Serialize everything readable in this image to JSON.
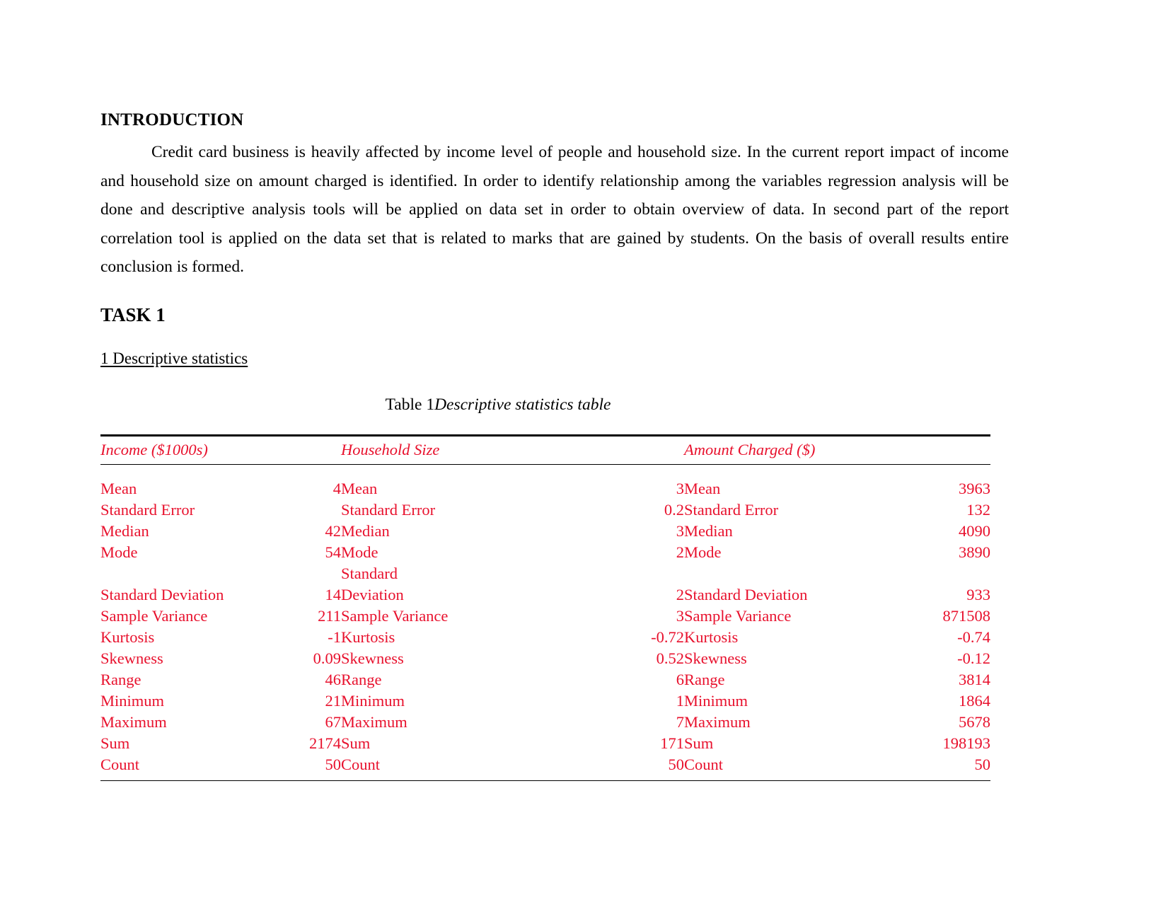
{
  "document": {
    "intro_heading": "INTRODUCTION",
    "intro_paragraph": "Credit card business is heavily affected by income level of people and household size. In the current report impact of income and household size on amount charged is identified. In order to identify relationship among the variables regression analysis will be done and descriptive analysis tools will be applied on data set in order to obtain overview of data. In second part of the report correlation tool is applied on the data set that is related to marks that are gained by students. On the basis of overall results entire conclusion is formed.",
    "task_heading": "TASK 1",
    "section_heading": "1 Descriptive statistics"
  },
  "table": {
    "caption_label": "Table 1",
    "caption_title": "Descriptive statistics table",
    "text_color": "#e8112d",
    "headers": [
      "Income ($1000s)",
      "Household Size",
      "Amount Charged ($)"
    ],
    "rows": [
      {
        "income_label": "Mean",
        "income_value": "4",
        "household_label": "Mean",
        "household_value": "3",
        "amount_label": "Mean",
        "amount_value": "3963"
      },
      {
        "income_label": "Standard Error",
        "income_value": "",
        "household_label": "Standard Error",
        "household_value": "0.2",
        "amount_label": "Standard Error",
        "amount_value": "132"
      },
      {
        "income_label": "Median",
        "income_value": "42",
        "household_label": "Median",
        "household_value": "3",
        "amount_label": "Median",
        "amount_value": "4090"
      },
      {
        "income_label": "Mode",
        "income_value": "54",
        "household_label": "Mode",
        "household_value": "2",
        "amount_label": "Mode",
        "amount_value": "3890"
      },
      {
        "income_label": "Standard Deviation",
        "income_value": "14",
        "household_label": "Standard Deviation",
        "household_value": "2",
        "amount_label": "Standard Deviation",
        "amount_value": "933"
      },
      {
        "income_label": "Sample Variance",
        "income_value": "211",
        "household_label": "Sample Variance",
        "household_value": "3",
        "amount_label": "Sample Variance",
        "amount_value": "871508"
      },
      {
        "income_label": "Kurtosis",
        "income_value": "-1",
        "household_label": "Kurtosis",
        "household_value": "-0.72",
        "amount_label": "Kurtosis",
        "amount_value": "-0.74"
      },
      {
        "income_label": "Skewness",
        "income_value": "0.09",
        "household_label": "Skewness",
        "household_value": "0.52",
        "amount_label": "Skewness",
        "amount_value": "-0.12"
      },
      {
        "income_label": "Range",
        "income_value": "46",
        "household_label": "Range",
        "household_value": "6",
        "amount_label": "Range",
        "amount_value": "3814"
      },
      {
        "income_label": "Minimum",
        "income_value": "21",
        "household_label": "Minimum",
        "household_value": "1",
        "amount_label": "Minimum",
        "amount_value": "1864"
      },
      {
        "income_label": "Maximum",
        "income_value": "67",
        "household_label": "Maximum",
        "household_value": "7",
        "amount_label": "Maximum",
        "amount_value": "5678"
      },
      {
        "income_label": "Sum",
        "income_value": "2174",
        "household_label": "Sum",
        "household_value": "171",
        "amount_label": "Sum",
        "amount_value": "198193"
      },
      {
        "income_label": "Count",
        "income_value": "50",
        "household_label": "Count",
        "household_value": "50",
        "amount_label": "Count",
        "amount_value": "50"
      }
    ]
  }
}
